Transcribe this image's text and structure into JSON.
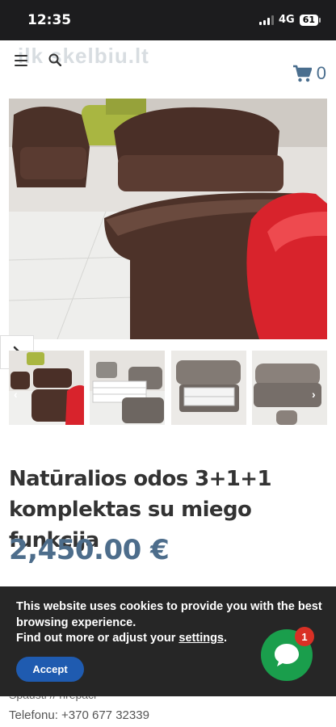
{
  "status_bar": {
    "time": "12:35",
    "network": "4G",
    "battery": "61"
  },
  "header": {
    "logo_text": "ilk skelbiu.lt",
    "cart_count": "0"
  },
  "gallery": {
    "prev_arrow": "‹",
    "next_arrow": "›"
  },
  "product": {
    "title": "Natūralios odos 3+1+1 komplektas su miego funkcija",
    "price": "2,450.00 €"
  },
  "cookie_banner": {
    "line1": "This website uses cookies to provide you with the best browsing experience.",
    "line2_prefix": "Find out more or adjust your ",
    "settings_link": "settings",
    "line2_suffix": ".",
    "accept_label": "Accept"
  },
  "chat": {
    "badge_count": "1"
  },
  "footer_info": {
    "partial_line": "Spausti // nrepaci",
    "phone": "Telefonu: +370 677 32339"
  },
  "colors": {
    "accent": "#4d6d8b",
    "accept_button": "#1f5bb0",
    "chat_button": "#1a9e4c",
    "badge": "#d93025",
    "cookie_bg": "#262626"
  }
}
